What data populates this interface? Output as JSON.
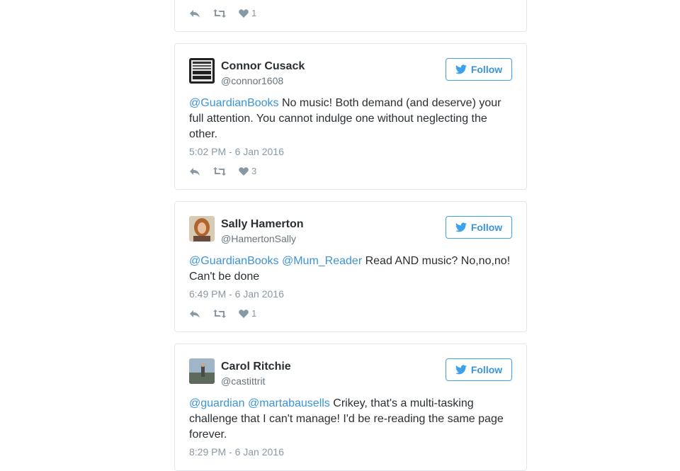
{
  "top_card": {
    "like_count": "1"
  },
  "tweets": [
    {
      "name": "Connor Cusack",
      "handle": "@connor1608",
      "follow_label": "Follow",
      "mention1": "@GuardianBooks",
      "text": " No music! Both demand (and deserve) your full attention. You cannot indulge one without neglecting the other.",
      "time": "5:02 PM - 6 Jan 2016",
      "like_count": "3"
    },
    {
      "name": "Sally Hamerton",
      "handle": "@HamertonSally",
      "follow_label": "Follow",
      "mention1": "@GuardianBooks",
      "mention2": "@Mum_Reader",
      "text": " Read AND music? No,no,no! Can't be done",
      "time": "6:49 PM - 6 Jan 2016",
      "like_count": "1"
    },
    {
      "name": "Carol Ritchie",
      "handle": "@castittrit",
      "follow_label": "Follow",
      "mention1": "@guardian",
      "mention2": "@martabausells",
      "text": " Crikey, that's a multi-tasking challenge that I can't manage! I'd be re-reading the same page forever.",
      "time": "8:29 PM - 6 Jan 2016"
    }
  ],
  "colors": {
    "link": "#3b94d9",
    "muted": "#8899a6",
    "border": "#e1e8ed"
  },
  "icons": [
    "reply-icon",
    "retweet-icon",
    "heart-icon",
    "twitter-bird-icon"
  ]
}
